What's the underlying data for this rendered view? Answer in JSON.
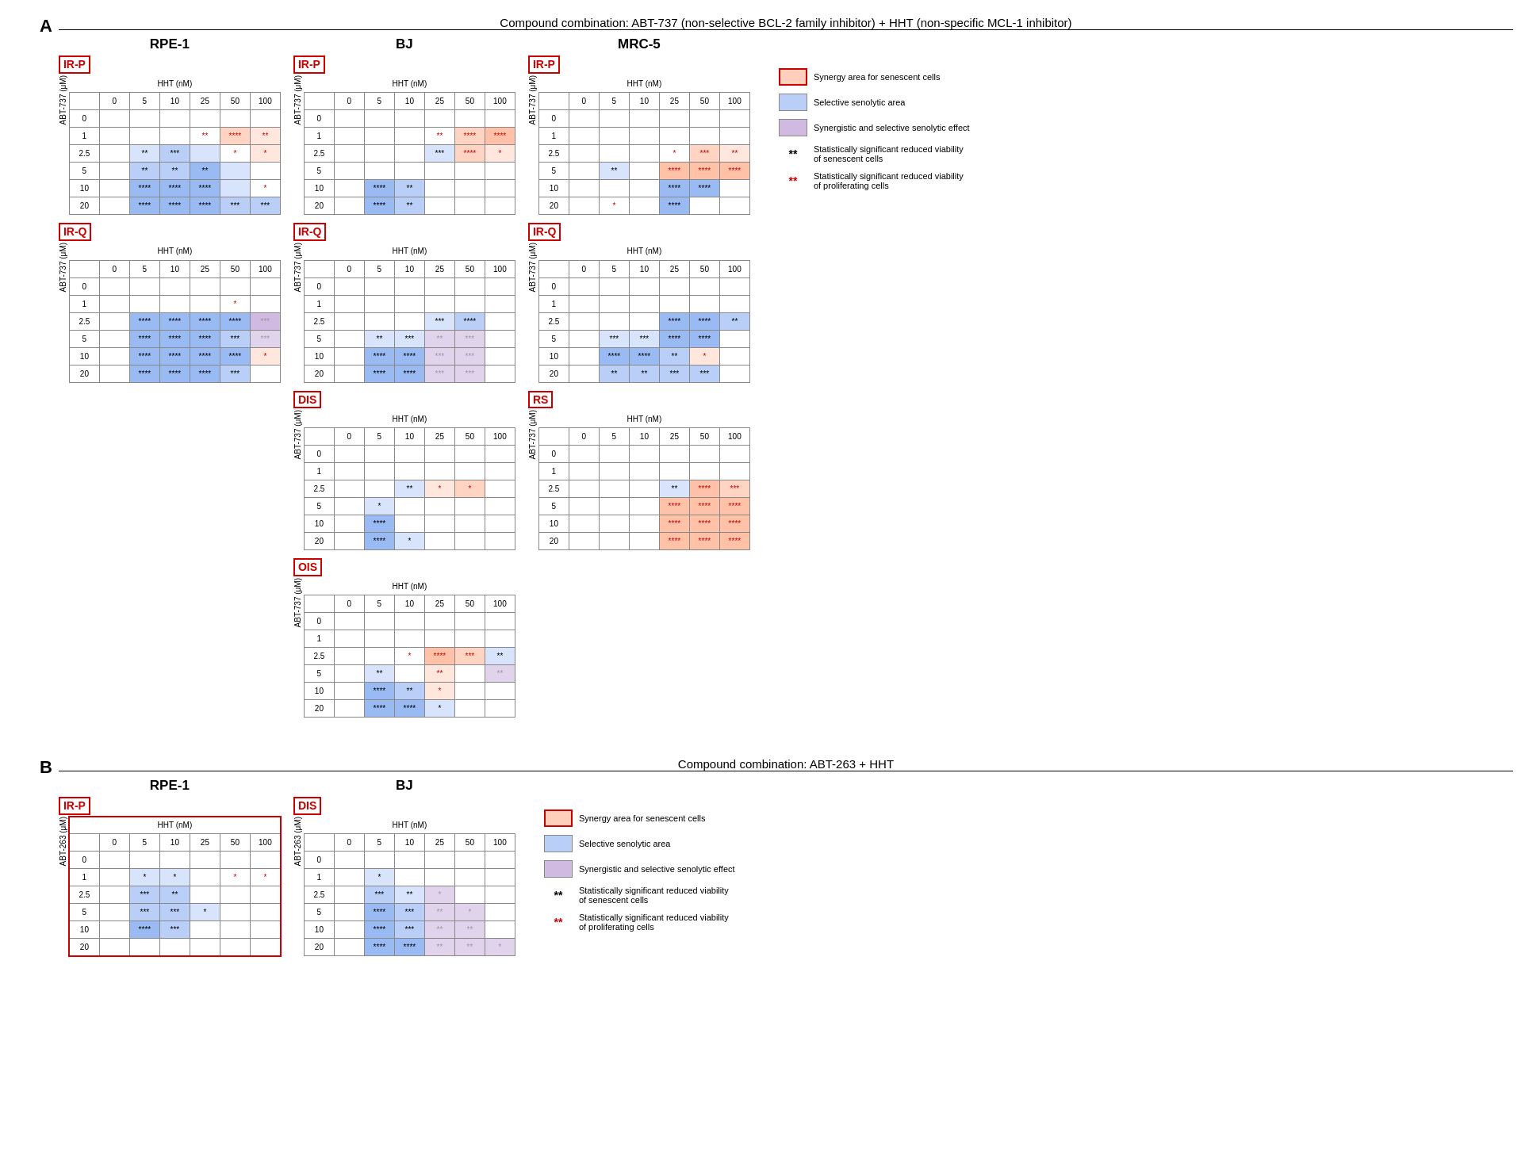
{
  "sectionA": {
    "label": "A",
    "title": "Compound combination: ABT-737 (non-selective BCL-2 family inhibitor) + HHT (non-specific MCL-1 inhibitor)",
    "columns": [
      "0",
      "5",
      "10",
      "25",
      "50",
      "100"
    ],
    "yValues": [
      "0",
      "1",
      "2.5",
      "5",
      "10",
      "20"
    ],
    "xLabel": "HHT (nM)",
    "yLabel": "ABT-737 (μM)",
    "panels": [
      {
        "cellLine": "RPE-1",
        "groups": [
          {
            "id": "IR-P",
            "rows": [
              [
                "",
                "",
                "",
                "",
                "",
                ""
              ],
              [
                "",
                "",
                "",
                "**r",
                "****r",
                "**r"
              ],
              [
                "",
                "**b",
                "***b",
                "",
                "*r",
                "*r"
              ],
              [
                "",
                "**b",
                "**b",
                "**b",
                "",
                ""
              ],
              [
                "",
                "****b",
                "****b",
                "****b",
                "",
                "*r"
              ],
              [
                "",
                "****b",
                "****b",
                "****b",
                "***b",
                "***b"
              ]
            ]
          },
          {
            "id": "IR-Q",
            "rows": [
              [
                "",
                "",
                "",
                "",
                "",
                ""
              ],
              [
                "",
                "",
                "",
                "",
                "*r",
                ""
              ],
              [
                "",
                "****b",
                "****b",
                "****b",
                "****b",
                "***g"
              ],
              [
                "",
                "****b",
                "****b",
                "****b",
                "***b",
                "***g"
              ],
              [
                "",
                "****b",
                "****b",
                "****b",
                "****b",
                "*r"
              ],
              [
                "",
                "****b",
                "****b",
                "****b",
                "***b",
                ""
              ]
            ]
          }
        ]
      },
      {
        "cellLine": "BJ",
        "groups": [
          {
            "id": "IR-P",
            "rows": [
              [
                "",
                "",
                "",
                "",
                "",
                ""
              ],
              [
                "",
                "",
                "",
                "**r",
                "****r",
                "****r"
              ],
              [
                "",
                "",
                "",
                "***b",
                "****r",
                "*r"
              ],
              [
                "",
                "",
                "",
                "",
                "",
                ""
              ],
              [
                "",
                "****b",
                "**b",
                "",
                "",
                ""
              ],
              [
                "",
                "****b",
                "**b",
                "",
                "",
                ""
              ]
            ]
          },
          {
            "id": "IR-Q",
            "rows": [
              [
                "",
                "",
                "",
                "",
                "",
                ""
              ],
              [
                "",
                "",
                "",
                "",
                "",
                ""
              ],
              [
                "",
                "",
                "",
                "***b",
                "****b",
                ""
              ],
              [
                "",
                "**b",
                "***b",
                "**g",
                "***g",
                ""
              ],
              [
                "",
                "****b",
                "****b",
                "***g",
                "***g",
                ""
              ],
              [
                "",
                "****b",
                "****b",
                "***g",
                "***g",
                ""
              ]
            ]
          },
          {
            "id": "DIS",
            "rows": [
              [
                "",
                "",
                "",
                "",
                "",
                ""
              ],
              [
                "",
                "",
                "",
                "",
                "",
                ""
              ],
              [
                "",
                "",
                "**b",
                "*r",
                "*r",
                ""
              ],
              [
                "",
                "*b",
                "",
                "",
                "",
                ""
              ],
              [
                "",
                "****b",
                "",
                "",
                "",
                ""
              ],
              [
                "",
                "****b",
                "*b",
                "",
                "",
                ""
              ]
            ]
          },
          {
            "id": "OIS",
            "rows": [
              [
                "",
                "",
                "",
                "",
                "",
                ""
              ],
              [
                "",
                "",
                "",
                "",
                "",
                ""
              ],
              [
                "",
                "",
                "*r",
                "****r",
                "***r",
                "**b"
              ],
              [
                "",
                "**b",
                "",
                "**r",
                "",
                "**g"
              ],
              [
                "",
                "****b",
                "**b",
                "*r",
                "",
                ""
              ],
              [
                "",
                "****b",
                "****b",
                "*b",
                "",
                ""
              ]
            ]
          }
        ]
      },
      {
        "cellLine": "MRC-5",
        "groups": [
          {
            "id": "IR-P",
            "rows": [
              [
                "",
                "",
                "",
                "",
                "",
                ""
              ],
              [
                "",
                "",
                "",
                "",
                "",
                ""
              ],
              [
                "",
                "",
                "",
                "*r",
                "***r",
                "**r"
              ],
              [
                "",
                "**b",
                "",
                "****r",
                "****r",
                "****r"
              ],
              [
                "",
                "",
                "",
                "****b",
                "****b",
                ""
              ],
              [
                "",
                "*r",
                "",
                "****b",
                "",
                ""
              ]
            ]
          },
          {
            "id": "IR-Q",
            "rows": [
              [
                "",
                "",
                "",
                "",
                "",
                ""
              ],
              [
                "",
                "",
                "",
                "",
                "",
                ""
              ],
              [
                "",
                "",
                "",
                "****b",
                "****b",
                "**b"
              ],
              [
                "",
                "***b",
                "***b",
                "****b",
                "****b",
                ""
              ],
              [
                "",
                "****b",
                "****b",
                "**b",
                "*r",
                ""
              ],
              [
                "",
                "**b",
                "**b",
                "***b",
                "***b",
                ""
              ]
            ]
          },
          {
            "id": "RS",
            "rows": [
              [
                "",
                "",
                "",
                "",
                "",
                ""
              ],
              [
                "",
                "",
                "",
                "",
                "",
                ""
              ],
              [
                "",
                "",
                "",
                "**b",
                "****r",
                "***r"
              ],
              [
                "",
                "",
                "",
                "****r",
                "****r",
                "****r"
              ],
              [
                "",
                "",
                "",
                "****r",
                "****r",
                "****r"
              ],
              [
                "",
                "",
                "",
                "****r",
                "****r",
                "****r"
              ]
            ]
          }
        ]
      }
    ],
    "legend": {
      "items": [
        {
          "type": "red-box",
          "text": "Synergy area for senescent cells"
        },
        {
          "type": "blue-box",
          "text": "Selective senolytic area"
        },
        {
          "type": "purple-box",
          "text": "Synergistic and selective senolytic effect"
        },
        {
          "type": "stars-black",
          "text": "Statistically significant reduced viability\nof senescent cells"
        },
        {
          "type": "stars-red",
          "text": "Statistically significant reduced viability\nof proliferating cells"
        }
      ]
    }
  },
  "sectionB": {
    "label": "B",
    "title": "Compound combination: ABT-263 + HHT",
    "columns": [
      "0",
      "5",
      "10",
      "25",
      "50",
      "100"
    ],
    "yValues": [
      "0",
      "1",
      "2.5",
      "5",
      "10",
      "20"
    ],
    "xLabel": "HHT (nM)",
    "yLabel": "ABT-263 (μM)",
    "panels": [
      {
        "cellLine": "RPE-1",
        "groups": [
          {
            "id": "IR-P",
            "rows": [
              [
                "",
                "",
                "",
                "",
                "",
                ""
              ],
              [
                "",
                "*b",
                "*b",
                "",
                "*r",
                "*r"
              ],
              [
                "",
                "***b",
                "**b",
                "",
                "",
                ""
              ],
              [
                "",
                "***b",
                "***b",
                "*b",
                "",
                ""
              ],
              [
                "",
                "****b",
                "***b",
                "",
                "",
                ""
              ],
              [
                "",
                "",
                "",
                "",
                "",
                ""
              ]
            ]
          }
        ]
      },
      {
        "cellLine": "BJ",
        "groups": [
          {
            "id": "DIS",
            "rows": [
              [
                "",
                "",
                "",
                "",
                "",
                ""
              ],
              [
                "",
                "*b",
                "",
                "",
                "",
                ""
              ],
              [
                "",
                "***b",
                "**b",
                "*r",
                "",
                ""
              ],
              [
                "",
                "****b",
                "***b",
                "**g",
                "*g",
                ""
              ],
              [
                "",
                "****b",
                "***b",
                "**g",
                "**g",
                ""
              ],
              [
                "",
                "****b",
                "****b",
                "**g",
                "**g",
                "*g"
              ]
            ]
          }
        ]
      }
    ],
    "legend": {
      "items": [
        {
          "type": "red-box",
          "text": "Synergy area for senescent cells"
        },
        {
          "type": "blue-box",
          "text": "Selective senolytic area"
        },
        {
          "type": "purple-box",
          "text": "Synergistic and selective senolytic effect"
        },
        {
          "type": "stars-black",
          "text": "Statistically significant reduced viability\nof senescent cells"
        },
        {
          "type": "stars-red",
          "text": "Statistically significant reduced viability\nof proliferating cells"
        }
      ]
    }
  }
}
